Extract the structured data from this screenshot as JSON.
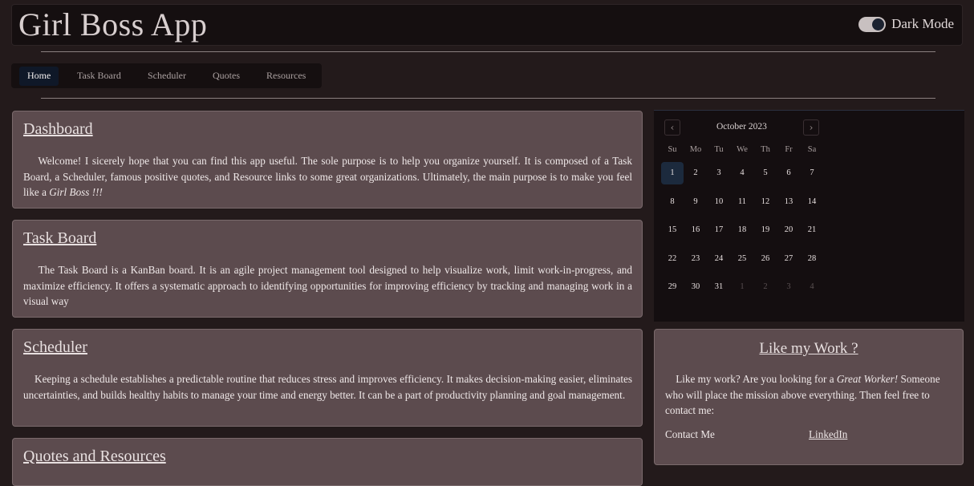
{
  "header": {
    "title": "Girl Boss App",
    "toggle_label": "Dark Mode"
  },
  "nav": {
    "items": [
      "Home",
      "Task Board",
      "Scheduler",
      "Quotes",
      "Resources"
    ]
  },
  "cards": [
    {
      "title": "Dashboard",
      "body_before": "Welcome! I sicerely hope that you can find this app useful. The sole purpose is to help you organize yourself. It is composed of a Task Board, a Scheduler, famous positive quotes, and Resource links to some great organizations. Ultimately, the main purpose is to make you feel like a ",
      "body_em": "Girl Boss !!!"
    },
    {
      "title": "Task Board",
      "body": "The Task Board is a KanBan board. It is an agile project management tool designed to help visualize work, limit work-in-progress, and maximize efficiency. It offers a systematic approach to identifying opportunities for improving efficiency by tracking and managing work in a visual way"
    },
    {
      "title": "Scheduler",
      "body": "Keeping a schedule establishes a predictable routine that reduces stress and improves efficiency. It makes decision-making easier, eliminates uncertainties, and builds healthy habits to manage your time and energy better. It can be a part of productivity planning and goal management."
    },
    {
      "title": "Quotes and Resources"
    }
  ],
  "calendar": {
    "month": "October 2023",
    "prev_icon": "‹",
    "next_icon": "›",
    "weekdays": [
      "Su",
      "Mo",
      "Tu",
      "We",
      "Th",
      "Fr",
      "Sa"
    ],
    "weeks": [
      [
        "1",
        "2",
        "3",
        "4",
        "5",
        "6",
        "7"
      ],
      [
        "8",
        "9",
        "10",
        "11",
        "12",
        "13",
        "14"
      ],
      [
        "15",
        "16",
        "17",
        "18",
        "19",
        "20",
        "21"
      ],
      [
        "22",
        "23",
        "24",
        "25",
        "26",
        "27",
        "28"
      ],
      [
        "29",
        "30",
        "31",
        "1",
        "2",
        "3",
        "4"
      ]
    ],
    "selected": "1"
  },
  "like": {
    "title": "Like my Work ?",
    "body_before": "Like my work? Are you looking for a ",
    "body_em": "Great Worker!",
    "body_after": " Someone who will place the mission above everything. Then feel free to contact me:",
    "contact_label": "Contact Me",
    "link": "LinkedIn"
  }
}
